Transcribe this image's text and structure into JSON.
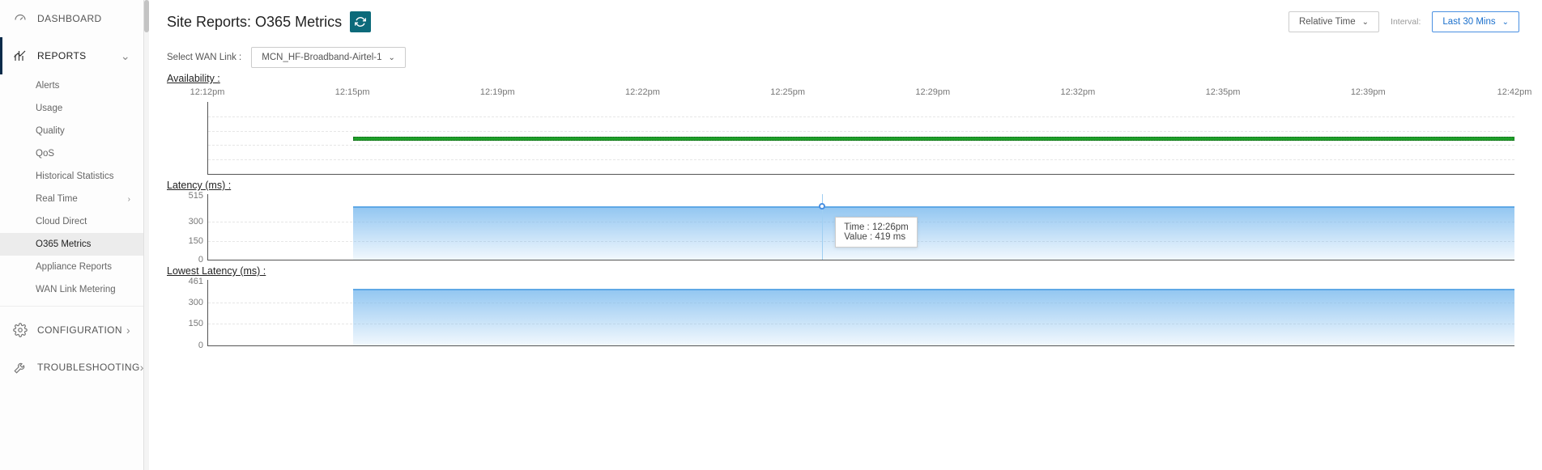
{
  "sidebar": {
    "items": [
      {
        "label": "DASHBOARD"
      },
      {
        "label": "REPORTS"
      },
      {
        "label": "CONFIGURATION"
      },
      {
        "label": "TROUBLESHOOTING"
      }
    ],
    "reports_children": [
      {
        "label": "Alerts"
      },
      {
        "label": "Usage"
      },
      {
        "label": "Quality"
      },
      {
        "label": "QoS"
      },
      {
        "label": "Historical Statistics"
      },
      {
        "label": "Real Time"
      },
      {
        "label": "Cloud Direct"
      },
      {
        "label": "O365 Metrics"
      },
      {
        "label": "Appliance Reports"
      },
      {
        "label": "WAN Link Metering"
      }
    ]
  },
  "header": {
    "title": "Site Reports: O365 Metrics",
    "relative_time_label": "Relative Time",
    "interval_label": "Interval:",
    "interval_value": "Last 30 Mins"
  },
  "filter": {
    "label": "Select WAN Link :",
    "value": "MCN_HF-Broadband-Airtel-1"
  },
  "sections": {
    "availability": "Availability :",
    "latency": "Latency (ms) :",
    "lowest_latency": "Lowest Latency (ms) :"
  },
  "tooltip": {
    "line1": "Time : 12:26pm",
    "line2": "Value : 419 ms"
  },
  "chart_data": [
    {
      "type": "line",
      "title": "Availability",
      "x_labels": [
        "12:12pm",
        "12:15pm",
        "12:19pm",
        "12:22pm",
        "12:25pm",
        "12:29pm",
        "12:32pm",
        "12:35pm",
        "12:39pm",
        "12:42pm"
      ],
      "y_ticks": [],
      "series": [
        {
          "name": "Availability",
          "color": "#1fa02a",
          "x": [
            "12:15pm",
            "12:42pm"
          ],
          "values": [
            1,
            1
          ]
        }
      ]
    },
    {
      "type": "area",
      "title": "Latency (ms)",
      "ylabel": "ms",
      "y_ticks": [
        0,
        150,
        300,
        515
      ],
      "ylim": [
        0,
        515
      ],
      "series": [
        {
          "name": "Latency",
          "x_range": [
            "12:15pm",
            "12:42pm"
          ],
          "approx_value": 419
        }
      ],
      "hover": {
        "time": "12:26pm",
        "value": 419,
        "unit": "ms"
      }
    },
    {
      "type": "area",
      "title": "Lowest Latency (ms)",
      "ylabel": "ms",
      "y_ticks": [
        0,
        150,
        300,
        461
      ],
      "ylim": [
        0,
        461
      ],
      "series": [
        {
          "name": "Lowest Latency",
          "x_range": [
            "12:15pm",
            "12:42pm"
          ],
          "approx_value": 400
        }
      ]
    }
  ],
  "x_axis": {
    "labels": [
      "12:12pm",
      "12:15pm",
      "12:19pm",
      "12:22pm",
      "12:25pm",
      "12:29pm",
      "12:32pm",
      "12:35pm",
      "12:39pm",
      "12:42pm"
    ]
  },
  "y_axes": {
    "latency": [
      "515",
      "300",
      "150",
      "0"
    ],
    "lowest": [
      "461",
      "300",
      "150",
      "0"
    ]
  }
}
